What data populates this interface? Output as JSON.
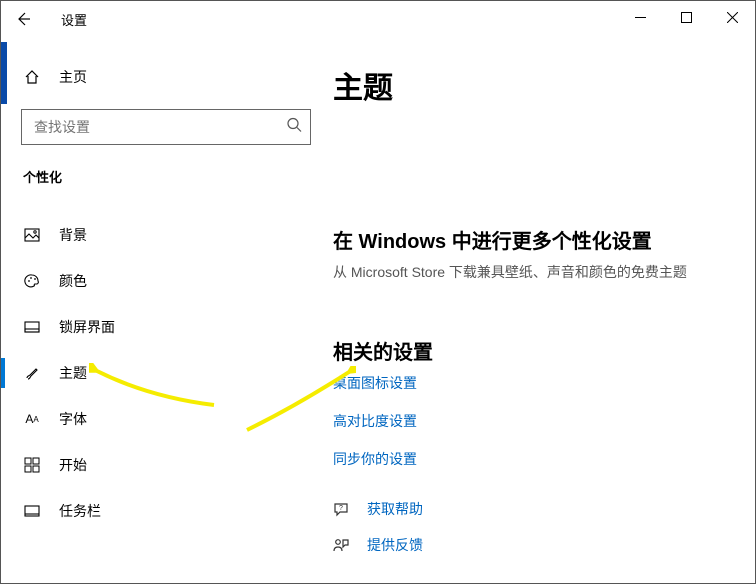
{
  "titlebar": {
    "title": "设置"
  },
  "sidebar": {
    "home": "主页",
    "search_placeholder": "查找设置",
    "section": "个性化",
    "items": [
      {
        "label": "背景"
      },
      {
        "label": "颜色"
      },
      {
        "label": "锁屏界面"
      },
      {
        "label": "主题"
      },
      {
        "label": "字体"
      },
      {
        "label": "开始"
      },
      {
        "label": "任务栏"
      }
    ]
  },
  "main": {
    "heading": "主题",
    "more_heading": "在 Windows 中进行更多个性化设置",
    "more_sub": "从 Microsoft Store 下载兼具壁纸、声音和颜色的免费主题",
    "related_heading": "相关的设置",
    "links": {
      "desktop_icons": "桌面图标设置",
      "high_contrast": "高对比度设置",
      "sync": "同步你的设置"
    },
    "help": {
      "get_help": "获取帮助",
      "feedback": "提供反馈"
    }
  }
}
